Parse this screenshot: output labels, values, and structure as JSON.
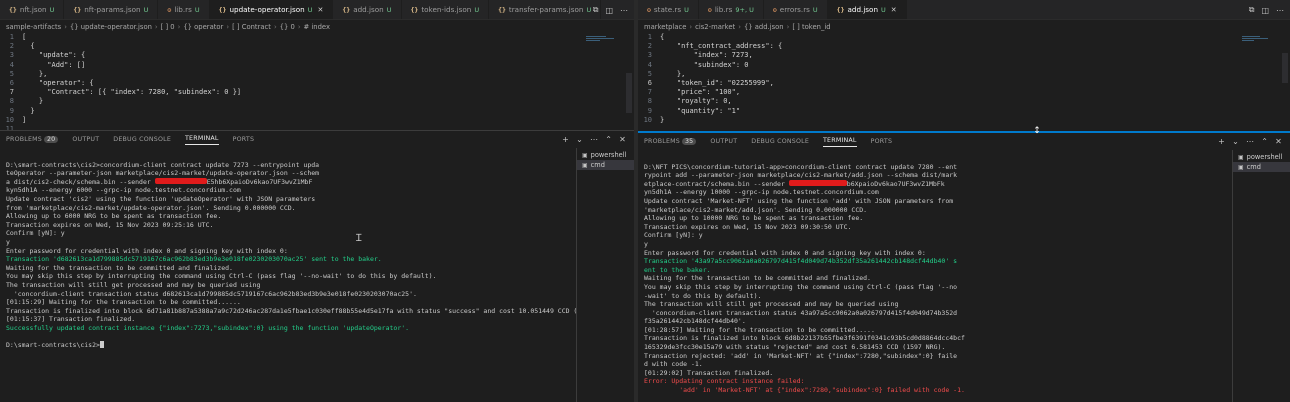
{
  "left": {
    "tabs": [
      {
        "icon": "{}",
        "label": "nft.json",
        "badge": "U",
        "active": false
      },
      {
        "icon": "{}",
        "label": "nft-params.json",
        "badge": "U",
        "active": false
      },
      {
        "icon": "rs",
        "label": "lib.rs",
        "badge": "U",
        "active": false
      },
      {
        "icon": "{}",
        "label": "update-operator.json",
        "badge": "U",
        "active": true
      },
      {
        "icon": "{}",
        "label": "add.json",
        "badge": "U",
        "active": false
      },
      {
        "icon": "{}",
        "label": "token-ids.json",
        "badge": "U",
        "active": false
      },
      {
        "icon": "{}",
        "label": "transfer-params.json",
        "badge": "U",
        "active": false
      }
    ],
    "breadcrumb": [
      "sample-artifacts",
      "{} update-operator.json",
      "[ ] 0",
      "{} operator",
      "[ ] Contract",
      "{} 0",
      "# index"
    ],
    "code": [
      "[",
      "  {",
      "    \"update\": {",
      "      \"Add\": []",
      "    },",
      "    \"operator\": {",
      "      \"Contract\": [{ \"index\": 7280, \"subindex\": 0 }]",
      "    }",
      "  }",
      "]",
      ""
    ],
    "current_line": 7,
    "panel": {
      "tabs": [
        "PROBLEMS",
        "OUTPUT",
        "DEBUG CONSOLE",
        "TERMINAL",
        "PORTS"
      ],
      "problems_count": "20",
      "active_tab": "TERMINAL",
      "terminals": [
        "powershell",
        "cmd"
      ],
      "selected_terminal": "cmd",
      "terminal_lines": [
        {
          "t": "",
          "c": ""
        },
        {
          "t": "D:\\smart-contracts\\cis2>concordium-client contract update 7273 --entrypoint upda",
          "c": ""
        },
        {
          "t": "teOperator --parameter-json marketplace/cis2-market/update-operator.json --schem",
          "c": ""
        },
        {
          "t": "a dist/cis2-check/schema.bin --sender ",
          "redact": 52,
          "after": "E5hb6XpaioDv6kao7UF3wvZ1MbF",
          "c": ""
        },
        {
          "t": "kyn5dh1A --energy 6000 --grpc-ip node.testnet.concordium.com",
          "c": ""
        },
        {
          "t": "Update contract 'cis2' using the function 'updateOperator' with JSON parameters",
          "c": ""
        },
        {
          "t": "from 'marketplace/cis2-market/update-operator.json'. Sending 0.000000 CCD.",
          "c": ""
        },
        {
          "t": "Allowing up to 6000 NRG to be spent as transaction fee.",
          "c": ""
        },
        {
          "t": "Transaction expires on Wed, 15 Nov 2023 09:25:16 UTC.",
          "c": ""
        },
        {
          "t": "Confirm [yN]: y",
          "c": ""
        },
        {
          "t": "y",
          "c": ""
        },
        {
          "t": "Enter password for credential with index 0 and signing key with index 0:",
          "c": ""
        },
        {
          "t": "Transaction 'd682613ca1d799885dc5719167c6ac962b83ed3b9e3e018fe0230203070ac25' sent to the baker.",
          "c": "g"
        },
        {
          "t": "Waiting for the transaction to be committed and finalized.",
          "c": ""
        },
        {
          "t": "You may skip this step by interrupting the command using Ctrl-C (pass flag '--no-wait' to do this by default).",
          "c": ""
        },
        {
          "t": "The transaction will still get processed and may be queried using",
          "c": ""
        },
        {
          "t": "  'concordium-client transaction status d682613ca1d799885dc5719167c6ac962b83ed3b9e3e018fe0230203070ac25'.",
          "c": ""
        },
        {
          "t": "[01:15:29] Waiting for the transaction to be committed......",
          "c": ""
        },
        {
          "t": "Transaction is finalized into block 6d71a81b887a5388a7a9c72d246ac287da1e5fbae1c030eff88b55e4d5e17fa with status \"success\" and cost 10.051449 CCD (2439 NRG).",
          "c": ""
        },
        {
          "t": "[01:15:37] Transaction finalized.",
          "c": ""
        },
        {
          "t": "Successfully updated contract instance {\"index\":7273,\"subindex\":0} using the function 'updateOperator'.",
          "c": "g"
        },
        {
          "t": "",
          "c": ""
        },
        {
          "t": "D:\\smart-contracts\\cis2>",
          "c": "",
          "cursor": true
        }
      ]
    }
  },
  "right": {
    "tabs": [
      {
        "icon": "rs",
        "label": "state.rs",
        "badge": "U",
        "active": false
      },
      {
        "icon": "rs",
        "label": "lib.rs",
        "badge": "9+, U",
        "active": false
      },
      {
        "icon": "rs",
        "label": "errors.rs",
        "badge": "U",
        "active": false
      },
      {
        "icon": "{}",
        "label": "add.json",
        "badge": "U",
        "active": true
      }
    ],
    "breadcrumb": [
      "marketplace",
      "cis2-market",
      "{} add.json",
      "[ ] token_id"
    ],
    "code": [
      "{",
      "    \"nft_contract_address\": {",
      "        \"index\": 7273,",
      "        \"subindex\": 0",
      "    },",
      "    \"token_id\": \"02255999\",",
      "    \"price\": \"100\",",
      "    \"royalty\": 0,",
      "    \"quantity\": \"1\"",
      "}"
    ],
    "current_line": 6,
    "panel": {
      "tabs": [
        "PROBLEMS",
        "OUTPUT",
        "DEBUG CONSOLE",
        "TERMINAL",
        "PORTS"
      ],
      "problems_count": "35",
      "active_tab": "TERMINAL",
      "terminals": [
        "powershell",
        "cmd"
      ],
      "selected_terminal": "cmd",
      "terminal_lines": [
        {
          "t": "",
          "c": ""
        },
        {
          "t": "D:\\NFT PICS\\concordium-tutorial-app>concordium-client contract update 7280 --ent",
          "c": ""
        },
        {
          "t": "rypoint add --parameter-json marketplace/cis2-market/add.json --schema dist/mark",
          "c": ""
        },
        {
          "t": "etplace-contract/schema.bin --sender ",
          "redact": 58,
          "after": "b6XpaioDv6kao7UF3wvZ1MbFk",
          "c": ""
        },
        {
          "t": "yn5dh1A --energy 10000 --grpc-ip node.testnet.concordium.com",
          "c": ""
        },
        {
          "t": "Update contract 'Market-NFT' using the function 'add' with JSON parameters from",
          "c": ""
        },
        {
          "t": "'marketplace/cis2-market/add.json'. Sending 0.000000 CCD.",
          "c": ""
        },
        {
          "t": "Allowing up to 10000 NRG to be spent as transaction fee.",
          "c": ""
        },
        {
          "t": "Transaction expires on Wed, 15 Nov 2023 09:30:50 UTC.",
          "c": ""
        },
        {
          "t": "Confirm [yN]: y",
          "c": ""
        },
        {
          "t": "y",
          "c": ""
        },
        {
          "t": "Enter password for credential with index 0 and signing key with index 0:",
          "c": ""
        },
        {
          "t": "Transaction '43a97a5cc9062a0a026797d415f4d049d74b352df35a261442cb148dcf44db40' s",
          "c": "g"
        },
        {
          "t": "ent to the baker.",
          "c": "g"
        },
        {
          "t": "Waiting for the transaction to be committed and finalized.",
          "c": ""
        },
        {
          "t": "You may skip this step by interrupting the command using Ctrl-C (pass flag '--no",
          "c": ""
        },
        {
          "t": "-wait' to do this by default).",
          "c": ""
        },
        {
          "t": "The transaction will still get processed and may be queried using",
          "c": ""
        },
        {
          "t": "  'concordium-client transaction status 43a97a5cc9062a0a026797d415f4d049d74b352d",
          "c": ""
        },
        {
          "t": "f35a261442cb148dcf44db40'.",
          "c": ""
        },
        {
          "t": "[01:28:57] Waiting for the transaction to be committed.....",
          "c": ""
        },
        {
          "t": "Transaction is finalized into block 6d8b22137b55fbe3f6391f0341c93b5cd0d8864dcc4bcf",
          "c": ""
        },
        {
          "t": "165329de3fcc30e15a79 with status \"rejected\" and cost 6.581453 CCD (1597 NRG).",
          "c": ""
        },
        {
          "t": "Transaction rejected: 'add' in 'Market-NFT' at {\"index\":7280,\"subindex\":0} faile",
          "c": ""
        },
        {
          "t": "d with code -1.",
          "c": ""
        },
        {
          "t": "[01:29:02] Transaction finalized.",
          "c": ""
        },
        {
          "t": "Error: Updating contract instance failed:",
          "c": "r"
        },
        {
          "t": "         'add' in 'Market-NFT' at {\"index\":7280,\"subindex\":0} failed with code -1.",
          "c": "r"
        }
      ]
    }
  }
}
